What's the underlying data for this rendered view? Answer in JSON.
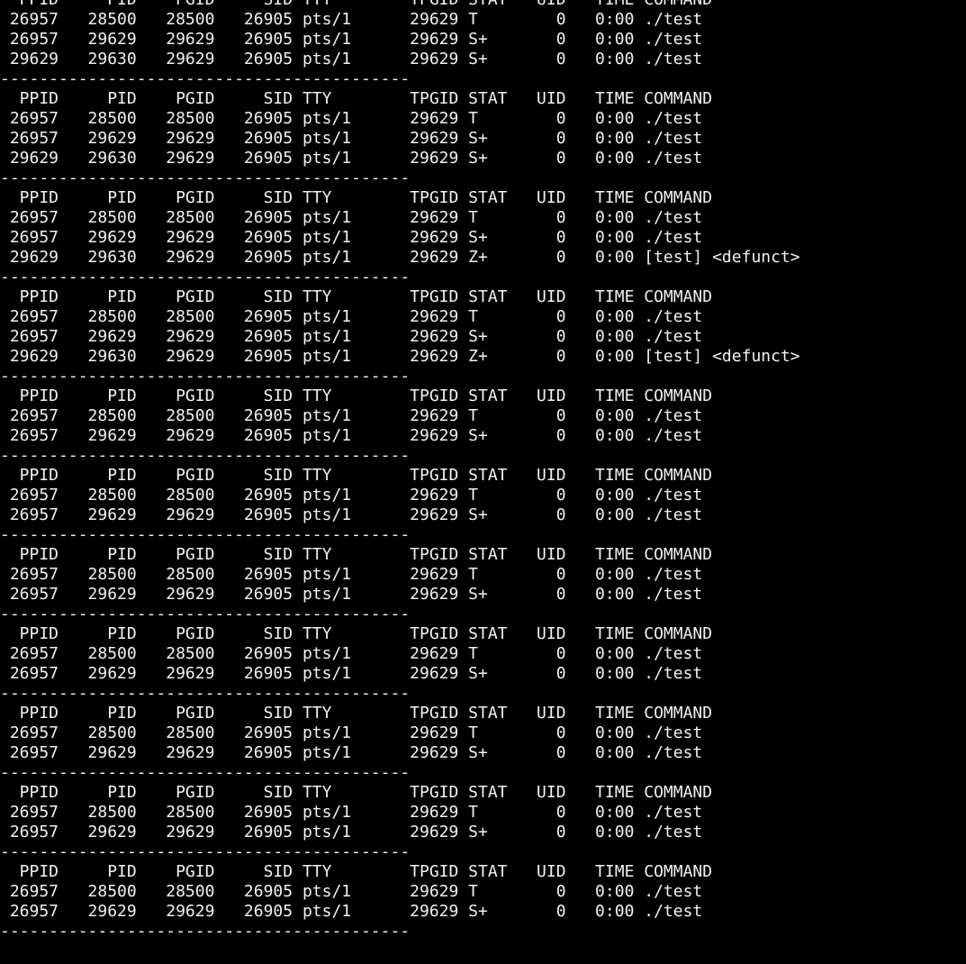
{
  "terminal": {
    "background": "#000000",
    "foreground": "#f2f2f2",
    "lines": [
      "  PPID     PID    PGID     SID TTY        TPGID STAT   UID   TIME COMMAND",
      " 26957   28500   28500   26905 pts/1      29629 T        0   0:00 ./test",
      " 26957   29629   29629   26905 pts/1      29629 S+       0   0:00 ./test",
      " 29629   29630   29629   26905 pts/1      29629 S+       0   0:00 ./test",
      "------------------------------------------",
      "  PPID     PID    PGID     SID TTY        TPGID STAT   UID   TIME COMMAND",
      " 26957   28500   28500   26905 pts/1      29629 T        0   0:00 ./test",
      " 26957   29629   29629   26905 pts/1      29629 S+       0   0:00 ./test",
      " 29629   29630   29629   26905 pts/1      29629 S+       0   0:00 ./test",
      "------------------------------------------",
      "  PPID     PID    PGID     SID TTY        TPGID STAT   UID   TIME COMMAND",
      " 26957   28500   28500   26905 pts/1      29629 T        0   0:00 ./test",
      " 26957   29629   29629   26905 pts/1      29629 S+       0   0:00 ./test",
      " 29629   29630   29629   26905 pts/1      29629 Z+       0   0:00 [test] <defunct>",
      "------------------------------------------",
      "  PPID     PID    PGID     SID TTY        TPGID STAT   UID   TIME COMMAND",
      " 26957   28500   28500   26905 pts/1      29629 T        0   0:00 ./test",
      " 26957   29629   29629   26905 pts/1      29629 S+       0   0:00 ./test",
      " 29629   29630   29629   26905 pts/1      29629 Z+       0   0:00 [test] <defunct>",
      "------------------------------------------",
      "  PPID     PID    PGID     SID TTY        TPGID STAT   UID   TIME COMMAND",
      " 26957   28500   28500   26905 pts/1      29629 T        0   0:00 ./test",
      " 26957   29629   29629   26905 pts/1      29629 S+       0   0:00 ./test",
      "------------------------------------------",
      "  PPID     PID    PGID     SID TTY        TPGID STAT   UID   TIME COMMAND",
      " 26957   28500   28500   26905 pts/1      29629 T        0   0:00 ./test",
      " 26957   29629   29629   26905 pts/1      29629 S+       0   0:00 ./test",
      "------------------------------------------",
      "  PPID     PID    PGID     SID TTY        TPGID STAT   UID   TIME COMMAND",
      " 26957   28500   28500   26905 pts/1      29629 T        0   0:00 ./test",
      " 26957   29629   29629   26905 pts/1      29629 S+       0   0:00 ./test",
      "------------------------------------------",
      "  PPID     PID    PGID     SID TTY        TPGID STAT   UID   TIME COMMAND",
      " 26957   28500   28500   26905 pts/1      29629 T        0   0:00 ./test",
      " 26957   29629   29629   26905 pts/1      29629 S+       0   0:00 ./test",
      "------------------------------------------",
      "  PPID     PID    PGID     SID TTY        TPGID STAT   UID   TIME COMMAND",
      " 26957   28500   28500   26905 pts/1      29629 T        0   0:00 ./test",
      " 26957   29629   29629   26905 pts/1      29629 S+       0   0:00 ./test",
      "------------------------------------------",
      "  PPID     PID    PGID     SID TTY        TPGID STAT   UID   TIME COMMAND",
      " 26957   28500   28500   26905 pts/1      29629 T        0   0:00 ./test",
      " 26957   29629   29629   26905 pts/1      29629 S+       0   0:00 ./test",
      "------------------------------------------",
      "  PPID     PID    PGID     SID TTY        TPGID STAT   UID   TIME COMMAND",
      " 26957   28500   28500   26905 pts/1      29629 T        0   0:00 ./test",
      " 26957   29629   29629   26905 pts/1      29629 S+       0   0:00 ./test",
      "------------------------------------------"
    ]
  }
}
